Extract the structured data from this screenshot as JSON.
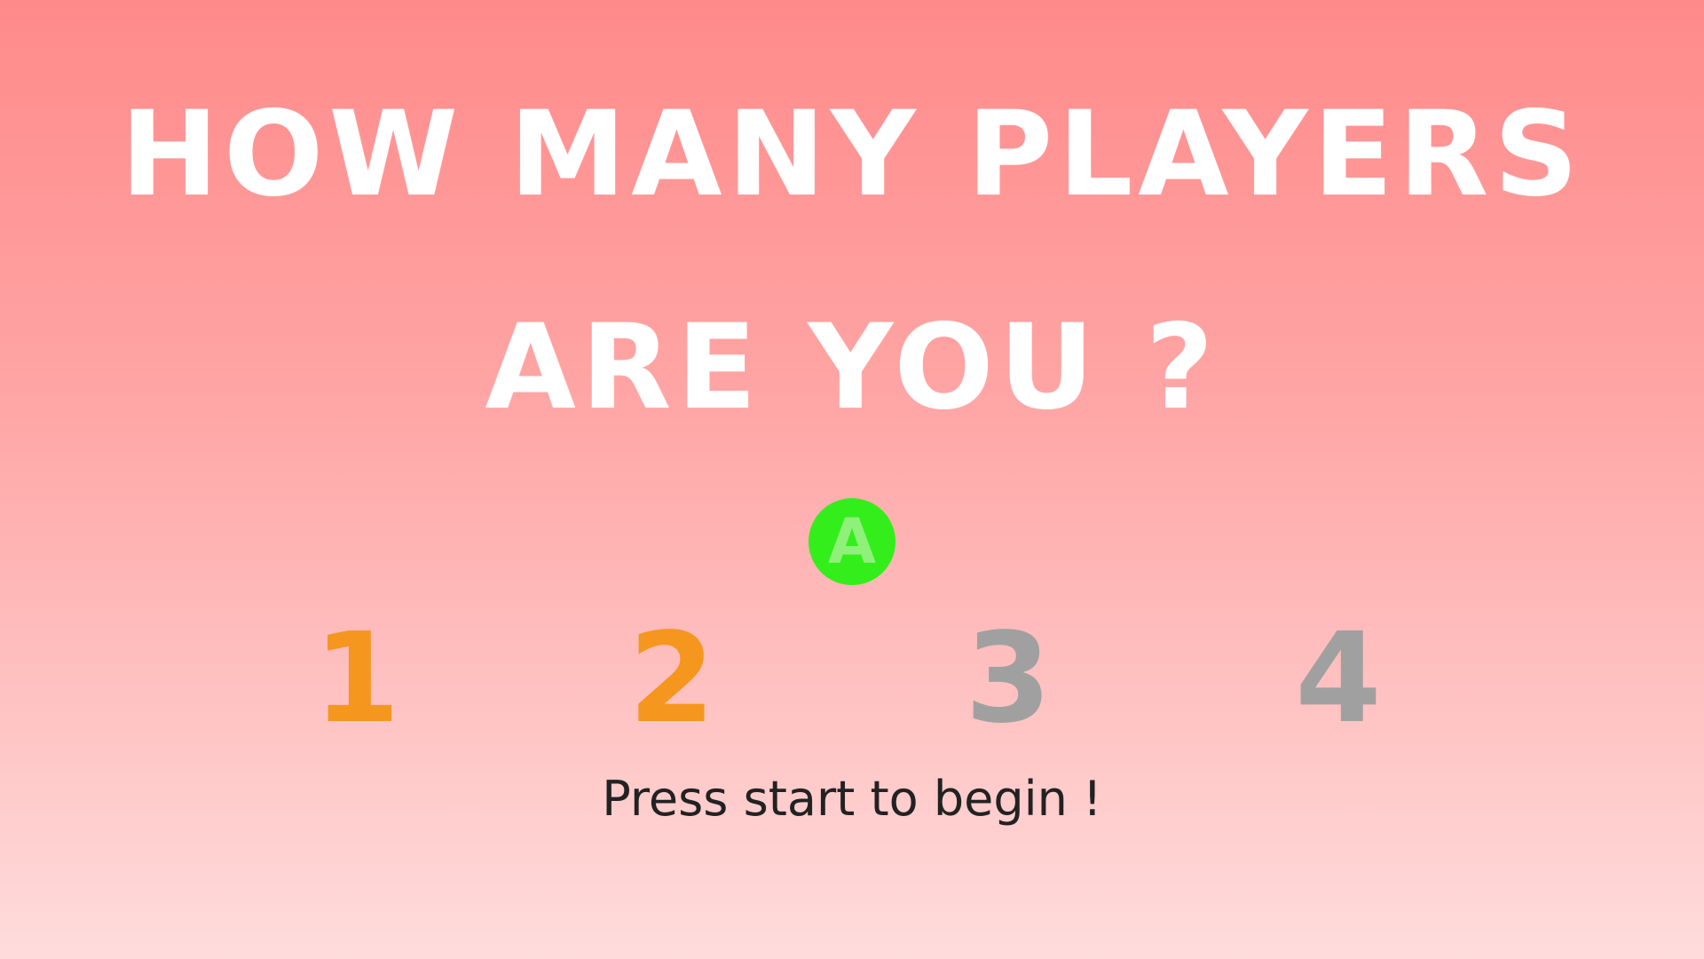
{
  "title": {
    "line1": "HOW MANY PLAYERS",
    "line2": "ARE YOU ?"
  },
  "a_button": {
    "label": "A",
    "bg_color": "#33ee1a",
    "text_color": "#8ff07a"
  },
  "player_options": [
    {
      "label": "1",
      "color": "#f5961e",
      "state": "available"
    },
    {
      "label": "2",
      "color": "#f5961e",
      "state": "selected"
    },
    {
      "label": "3",
      "color": "#a0a0a0",
      "state": "unavailable"
    },
    {
      "label": "4",
      "color": "#a0a0a0",
      "state": "unavailable"
    }
  ],
  "prompt": {
    "text": "Press start to begin !",
    "color": "#222222"
  },
  "colors": {
    "title": "#ffffff",
    "background_top": "#ff8a8a",
    "background_bottom": "#ffdcdc"
  }
}
